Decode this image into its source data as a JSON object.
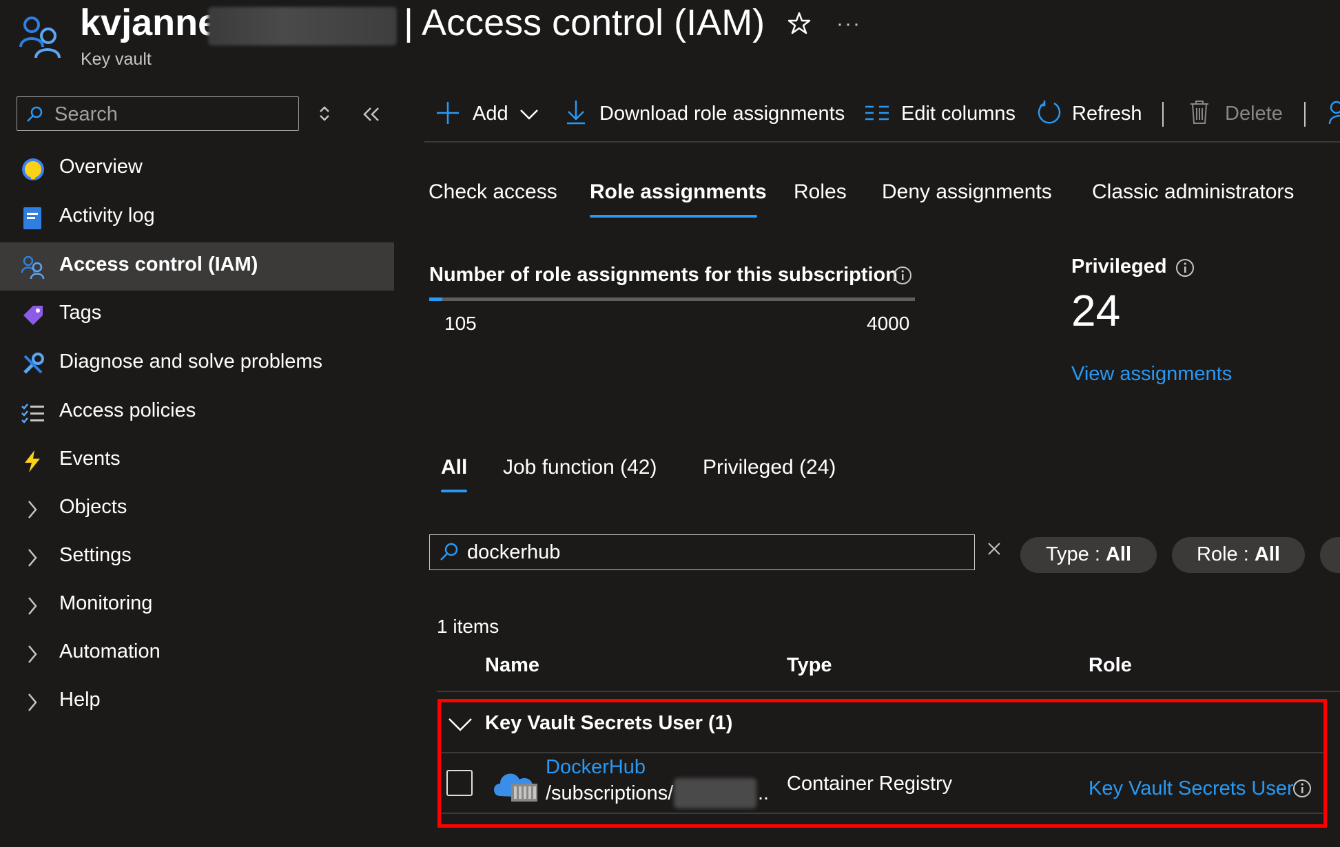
{
  "header": {
    "resource_name": "kvjanne",
    "page_title": "| Access control (IAM)",
    "resource_type": "Key vault",
    "favorite_icon": "star-icon",
    "more_icon": "more-icon",
    "more_label": "···"
  },
  "sidebar": {
    "search_placeholder": "Search",
    "items": [
      {
        "label": "Overview",
        "icon": "overview-icon"
      },
      {
        "label": "Activity log",
        "icon": "activity-log-icon"
      },
      {
        "label": "Access control (IAM)",
        "icon": "iam-icon",
        "selected": true
      },
      {
        "label": "Tags",
        "icon": "tag-icon"
      },
      {
        "label": "Diagnose and solve problems",
        "icon": "wrench-icon"
      },
      {
        "label": "Access policies",
        "icon": "list-check-icon"
      },
      {
        "label": "Events",
        "icon": "lightning-icon"
      },
      {
        "label": "Objects",
        "icon": "chevron-right-icon"
      },
      {
        "label": "Settings",
        "icon": "chevron-right-icon"
      },
      {
        "label": "Monitoring",
        "icon": "chevron-right-icon"
      },
      {
        "label": "Automation",
        "icon": "chevron-right-icon"
      },
      {
        "label": "Help",
        "icon": "chevron-right-icon"
      }
    ]
  },
  "toolbar": {
    "add": "Add",
    "download": "Download role assignments",
    "edit_columns": "Edit columns",
    "refresh": "Refresh",
    "delete": "Delete"
  },
  "tabs": [
    "Check access",
    "Role assignments",
    "Roles",
    "Deny assignments",
    "Classic administrators"
  ],
  "active_tab": "Role assignments",
  "stats": {
    "label": "Number of role assignments for this subscription",
    "current": 105,
    "max": 4000,
    "current_label": "105",
    "max_label": "4000",
    "privileged_label": "Privileged",
    "privileged_count": "24",
    "view_link": "View assignments"
  },
  "filter_tabs": [
    "All",
    "Job function (42)",
    "Privileged (24)"
  ],
  "filter": {
    "value": "dockerhub",
    "type_label": "Type : ",
    "type_value": "All",
    "role_label": "Role : ",
    "role_value": "All"
  },
  "table": {
    "items_count": "1 items",
    "columns": [
      "Name",
      "Type",
      "Role"
    ],
    "group": "Key Vault Secrets User (1)",
    "rows": [
      {
        "name": "DockerHub",
        "scope": "/subscriptions/",
        "scope_ellipsis": "..",
        "type": "Container Registry",
        "role": "Key Vault Secrets User"
      }
    ]
  },
  "colors": {
    "accent": "#2899f5",
    "background": "#1b1a19",
    "highlight": "#ff0000"
  }
}
